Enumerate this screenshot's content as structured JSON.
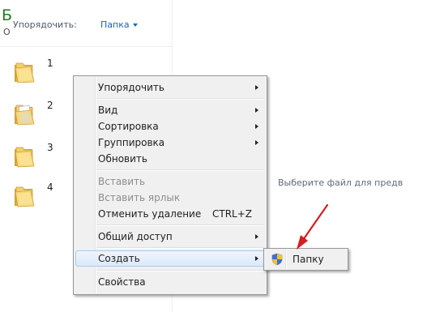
{
  "pane": {
    "title_letter": "Б",
    "subtitle_letter": "О",
    "arrange_label": "Упорядочить:",
    "arrange_value": "Папка"
  },
  "folders": [
    {
      "label": "1",
      "icon": "folder-icon"
    },
    {
      "label": "2",
      "icon": "folder-with-documents-icon"
    },
    {
      "label": "3",
      "icon": "folder-icon"
    },
    {
      "label": "4",
      "icon": "folder-icon"
    }
  ],
  "context_menu": {
    "items": [
      {
        "label": "Упорядочить"
      },
      {
        "label": "Вид"
      },
      {
        "label": "Сортировка"
      },
      {
        "label": "Группировка"
      },
      {
        "label": "Обновить"
      },
      {
        "label": "Вставить"
      },
      {
        "label": "Вставить ярлык"
      },
      {
        "label": "Отменить удаление",
        "shortcut": "CTRL+Z"
      },
      {
        "label": "Общий доступ"
      },
      {
        "label": "Создать"
      },
      {
        "label": "Свойства"
      }
    ]
  },
  "submenu": {
    "item_label": "Папку",
    "icon": "uac-shield-icon"
  },
  "preview": {
    "hint": "Выберите файл для предв"
  },
  "colors": {
    "accent_link": "#1e63b5",
    "menu_highlight": "#dbe9f9",
    "arrow": "#d21f1f"
  }
}
